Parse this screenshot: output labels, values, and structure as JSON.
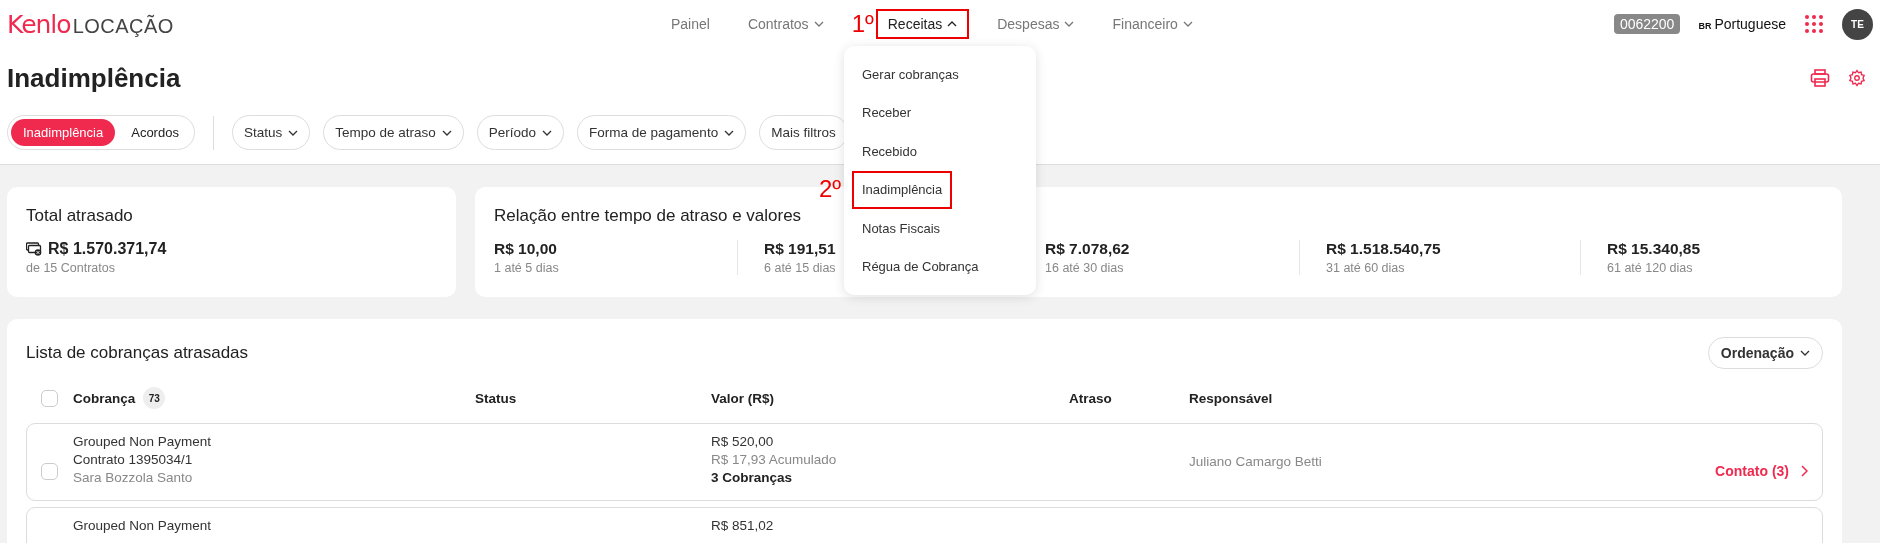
{
  "header": {
    "logo": {
      "brand": "Kenlo",
      "product": "LOCAÇÃO"
    },
    "nav": [
      {
        "label": "Painel",
        "kind": "link",
        "selected": false
      },
      {
        "label": "Contratos",
        "kind": "menu",
        "expanded": false,
        "selected": false
      },
      {
        "label": "Receitas",
        "kind": "menu",
        "expanded": true,
        "selected": true,
        "annotation": "1º"
      },
      {
        "label": "Despesas",
        "kind": "menu",
        "expanded": false,
        "selected": false
      },
      {
        "label": "Financeiro",
        "kind": "menu",
        "expanded": false,
        "selected": false
      }
    ],
    "account_code": "0062200",
    "language": {
      "flag": "BR",
      "label": "Portuguese"
    },
    "avatar": "TE"
  },
  "menu": {
    "items": [
      {
        "label": "Gerar cobranças"
      },
      {
        "label": "Receber"
      },
      {
        "label": "Recebido"
      },
      {
        "label": "Inadimplência",
        "annotation": "2º"
      },
      {
        "label": "Notas Fiscais"
      },
      {
        "label": "Régua de Cobrança"
      }
    ]
  },
  "page": {
    "title": "Inadimplência",
    "segments": [
      {
        "label": "Inadimplência",
        "selected": true
      },
      {
        "label": "Acordos",
        "selected": false
      }
    ],
    "filters": [
      {
        "label": "Status",
        "caret": true
      },
      {
        "label": "Tempo de atraso",
        "caret": true
      },
      {
        "label": "Período",
        "caret": true
      },
      {
        "label": "Forma de pagamento",
        "caret": true
      },
      {
        "label": "Mais filtros",
        "caret": false
      }
    ]
  },
  "summary": {
    "total": {
      "title": "Total atrasado",
      "amount": "R$ 1.570.371,74",
      "caption": "de 15 Contratos"
    },
    "relation": {
      "title": "Relação entre tempo de atraso e valores",
      "buckets": [
        {
          "value": "R$ 10,00",
          "range": "1 até 5 dias"
        },
        {
          "value": "R$ 191,51",
          "range": "6 até 15 dias"
        },
        {
          "value": "R$ 7.078,62",
          "range": "16 até 30 dias"
        },
        {
          "value": "R$ 1.518.540,75",
          "range": "31 até 60 dias"
        },
        {
          "value": "R$ 15.340,85",
          "range": "61 até 120 dias"
        }
      ]
    }
  },
  "list": {
    "title": "Lista de cobranças atrasadas",
    "sort_label": "Ordenação",
    "select_all": {
      "checked": false
    },
    "columns": [
      {
        "label": "Cobrança",
        "count": "73"
      },
      {
        "label": "Status"
      },
      {
        "label": "Valor (R$)"
      },
      {
        "label": "Atraso"
      },
      {
        "label": "Responsável"
      }
    ],
    "rows": [
      {
        "checked": false,
        "type": "Grouped Non Payment",
        "contract": "Contrato 1395034/1",
        "client": "Sara Bozzola Santo",
        "value": "R$ 520,00",
        "accumulated": "R$ 17,93 Acumulado",
        "charges": "3 Cobranças",
        "responsible": "Juliano Camargo Betti",
        "contact": "Contato (3)"
      },
      {
        "type": "Grouped Non Payment",
        "value": "R$ 851,02"
      }
    ]
  }
}
